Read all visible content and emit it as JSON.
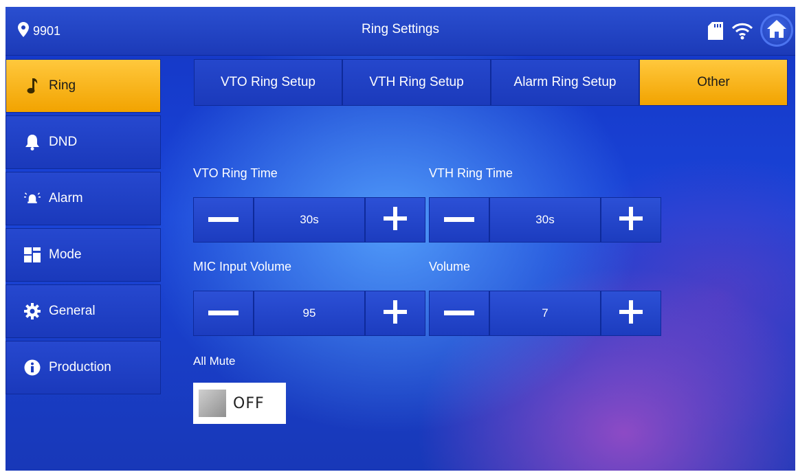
{
  "header": {
    "location_id": "9901",
    "title": "Ring Settings",
    "status_icons": [
      "sd-card-icon",
      "wifi-icon"
    ],
    "home_icon": "home-icon"
  },
  "sidebar": {
    "items": [
      {
        "label": "Ring",
        "icon": "music-note-icon",
        "active": true
      },
      {
        "label": "DND",
        "icon": "bell-icon",
        "active": false
      },
      {
        "label": "Alarm",
        "icon": "alarm-icon",
        "active": false
      },
      {
        "label": "Mode",
        "icon": "mode-grid-icon",
        "active": false
      },
      {
        "label": "General",
        "icon": "gear-icon",
        "active": false
      },
      {
        "label": "Production",
        "icon": "info-icon",
        "active": false
      }
    ]
  },
  "tabs": [
    {
      "label": "VTO Ring Setup",
      "active": false
    },
    {
      "label": "VTH Ring Setup",
      "active": false
    },
    {
      "label": "Alarm Ring Setup",
      "active": false
    },
    {
      "label": "Other",
      "active": true
    }
  ],
  "settings": {
    "vto_ring_time": {
      "label": "VTO Ring Time",
      "value": "30s"
    },
    "vth_ring_time": {
      "label": "VTH Ring Time",
      "value": "30s"
    },
    "mic_input_volume": {
      "label": "MIC Input Volume",
      "value": "95"
    },
    "volume": {
      "label": "Volume",
      "value": "7"
    },
    "all_mute": {
      "label": "All Mute",
      "state": "OFF"
    }
  },
  "colors": {
    "accent": "#f7b21b",
    "panel": "#1c3cbf",
    "background": "#1a44d8"
  }
}
